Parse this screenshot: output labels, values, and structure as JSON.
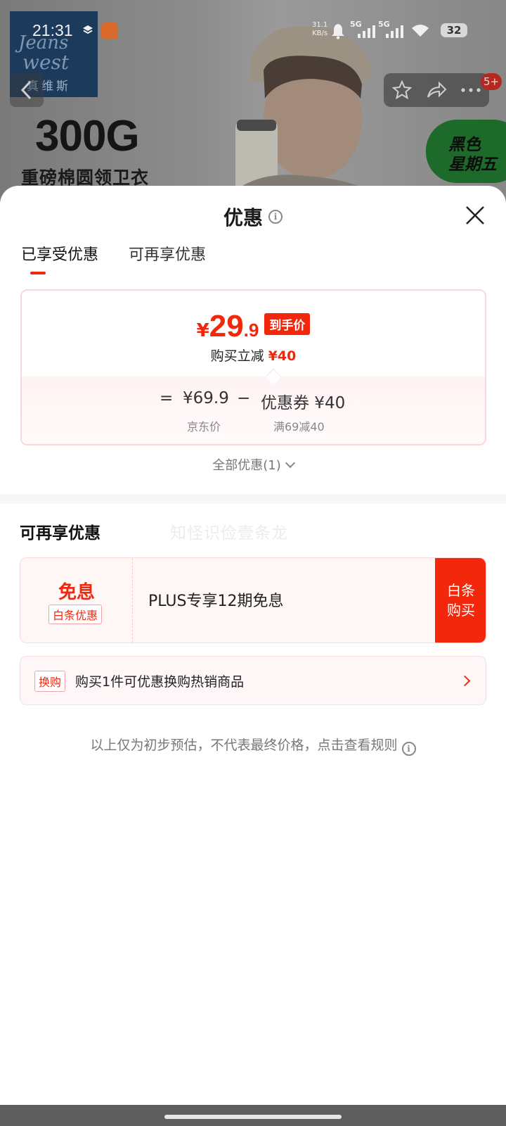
{
  "status_bar": {
    "time": "21:31",
    "net_speed_value": "31.1",
    "net_speed_unit": "KB/s",
    "signal_1": "5G",
    "signal_2": "5G",
    "battery": "32"
  },
  "background_page": {
    "brand_line1": "Jeans",
    "brand_line2": "west",
    "brand_cn": "真维斯",
    "promo_big": "300G",
    "promo_sub": "重磅棉圆领卫衣",
    "badge_line1": "黑色",
    "badge_line2": "星期五",
    "message_count": "5+"
  },
  "sheet": {
    "title": "优惠",
    "tabs": [
      {
        "label": "已享受优惠",
        "active": true
      },
      {
        "label": "可再享优惠",
        "active": false
      }
    ],
    "price_card": {
      "currency": "¥",
      "price_int": "29",
      "price_dec": ".9",
      "final_tag": "到手价",
      "save_label": "购买立减",
      "save_amount": "¥40",
      "eq": "=",
      "jd_price": "¥69.9",
      "minus": "−",
      "coupon_label": "优惠券 ¥40",
      "jd_price_caption": "京东价",
      "coupon_caption": "满69减40"
    },
    "all_offers": "全部优惠(1)",
    "section_title": "可再享优惠",
    "watermark": "知怪识俭壹条龙",
    "installment": {
      "main": "免息",
      "tag": "白条优惠",
      "desc": "PLUS专享12期免息",
      "button_line1": "白条",
      "button_line2": "购买"
    },
    "swap": {
      "tag": "换购",
      "text": "购买1件可优惠换购热销商品"
    },
    "disclaimer": "以上仅为初步预估，不代表最终价格，点击查看规则"
  },
  "colors": {
    "accent_red": "#f2270c",
    "card_border": "#fad7da"
  }
}
